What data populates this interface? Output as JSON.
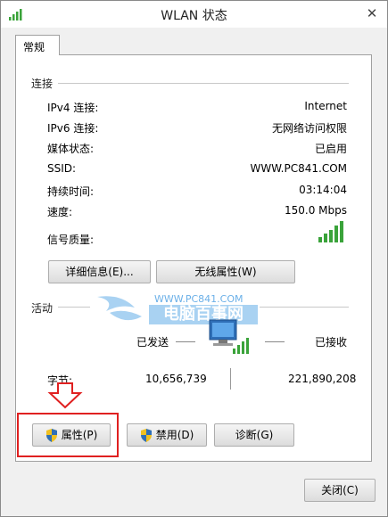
{
  "window": {
    "title": "WLAN 状态",
    "close_glyph": "✕"
  },
  "tab": {
    "label": "常规"
  },
  "connection": {
    "section_label": "连接",
    "rows": [
      {
        "label": "IPv4 连接:",
        "value": "Internet"
      },
      {
        "label": "IPv6 连接:",
        "value": "无网络访问权限"
      },
      {
        "label": "媒体状态:",
        "value": "已启用"
      },
      {
        "label": "SSID:",
        "value": "WWW.PC841.COM"
      },
      {
        "label": "持续时间:",
        "value": "03:14:04"
      },
      {
        "label": "速度:",
        "value": "150.0 Mbps"
      }
    ],
    "signal_label": "信号质量:",
    "signal_icon": "signal-bars-icon",
    "details_button": "详细信息(E)...",
    "wireless_props_button": "无线属性(W)"
  },
  "activity": {
    "section_label": "活动",
    "sent_label": "已发送",
    "received_label": "已接收",
    "bytes_label": "字节:",
    "bytes_sent": "10,656,739",
    "bytes_received": "221,890,208",
    "network_icon": "network-computer-icon"
  },
  "buttons": {
    "properties": "属性(P)",
    "disable": "禁用(D)",
    "diagnose": "诊断(G)",
    "close": "关闭(C)"
  },
  "watermark": {
    "url": "WWW.PC841.COM",
    "name": "电脑百事网"
  },
  "colors": {
    "accent_green": "#3aa33a",
    "highlight_red": "#e02020",
    "watermark_blue": "#5aa9e6"
  }
}
